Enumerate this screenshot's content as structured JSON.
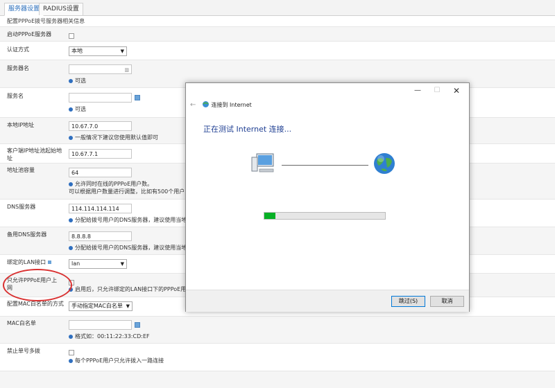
{
  "tabs": [
    "服务器设置",
    "RADIUS设置"
  ],
  "subtitle": "配置PPPoE拨号服务器相关信息",
  "form": {
    "enable_label": "启动PPPoE服务器",
    "auth_label": "认证方式",
    "auth_value": "本地",
    "server_name_label": "服务器名",
    "optional_hint": "可选",
    "service_name_label": "服务名",
    "local_ip_label": "本地IP地址",
    "local_ip_value": "10.67.7.0",
    "local_ip_hint": "一般情况下建议您使用默认值即可",
    "pool_start_label": "客户端IP地址池起始地址",
    "pool_start_value": "10.67.7.1",
    "pool_size_label": "地址池容量",
    "pool_size_value": "64",
    "pool_size_hint1": "允许同时在线的PPPoE用户数。",
    "pool_size_hint2": "可以根据用户数量进行调整，比如有500个用户，",
    "dns_label": "DNS服务器",
    "dns_value": "114.114.114.114",
    "dns_hint": "分配给拨号用户的DNS服务器，建议使用当地",
    "dns2_label": "备用DNS服务器",
    "dns2_value": "8.8.8.8",
    "dns2_hint": "分配给拨号用户的DNS服务器，建议使用当地",
    "lan_label": "绑定的LAN接口",
    "lan_value": "lan",
    "only_label": "只允许PPPoE用户上网",
    "only_hint": "启用后，只允许绑定的LAN接口下的PPPoE用",
    "mac_mode_label": "配置MAC白名单的方式",
    "mac_mode_value": "手动指定MAC白名单",
    "mac_list_label": "MAC白名单",
    "mac_hint": "格式如：00:11:22:33:CD:EF",
    "multi_label": "禁止单号多拨",
    "multi_hint": "每个PPPoE用户只允许拨入一路连接"
  },
  "dialog": {
    "title": "连接到 Internet",
    "heading": "正在测试 Internet 连接...",
    "progress_pct": 9,
    "skip_label": "跳过(S)",
    "cancel_label": "取消"
  },
  "colors": {
    "annotation": "#d93030",
    "progress": "#06b025",
    "heading": "#1e3e92"
  }
}
